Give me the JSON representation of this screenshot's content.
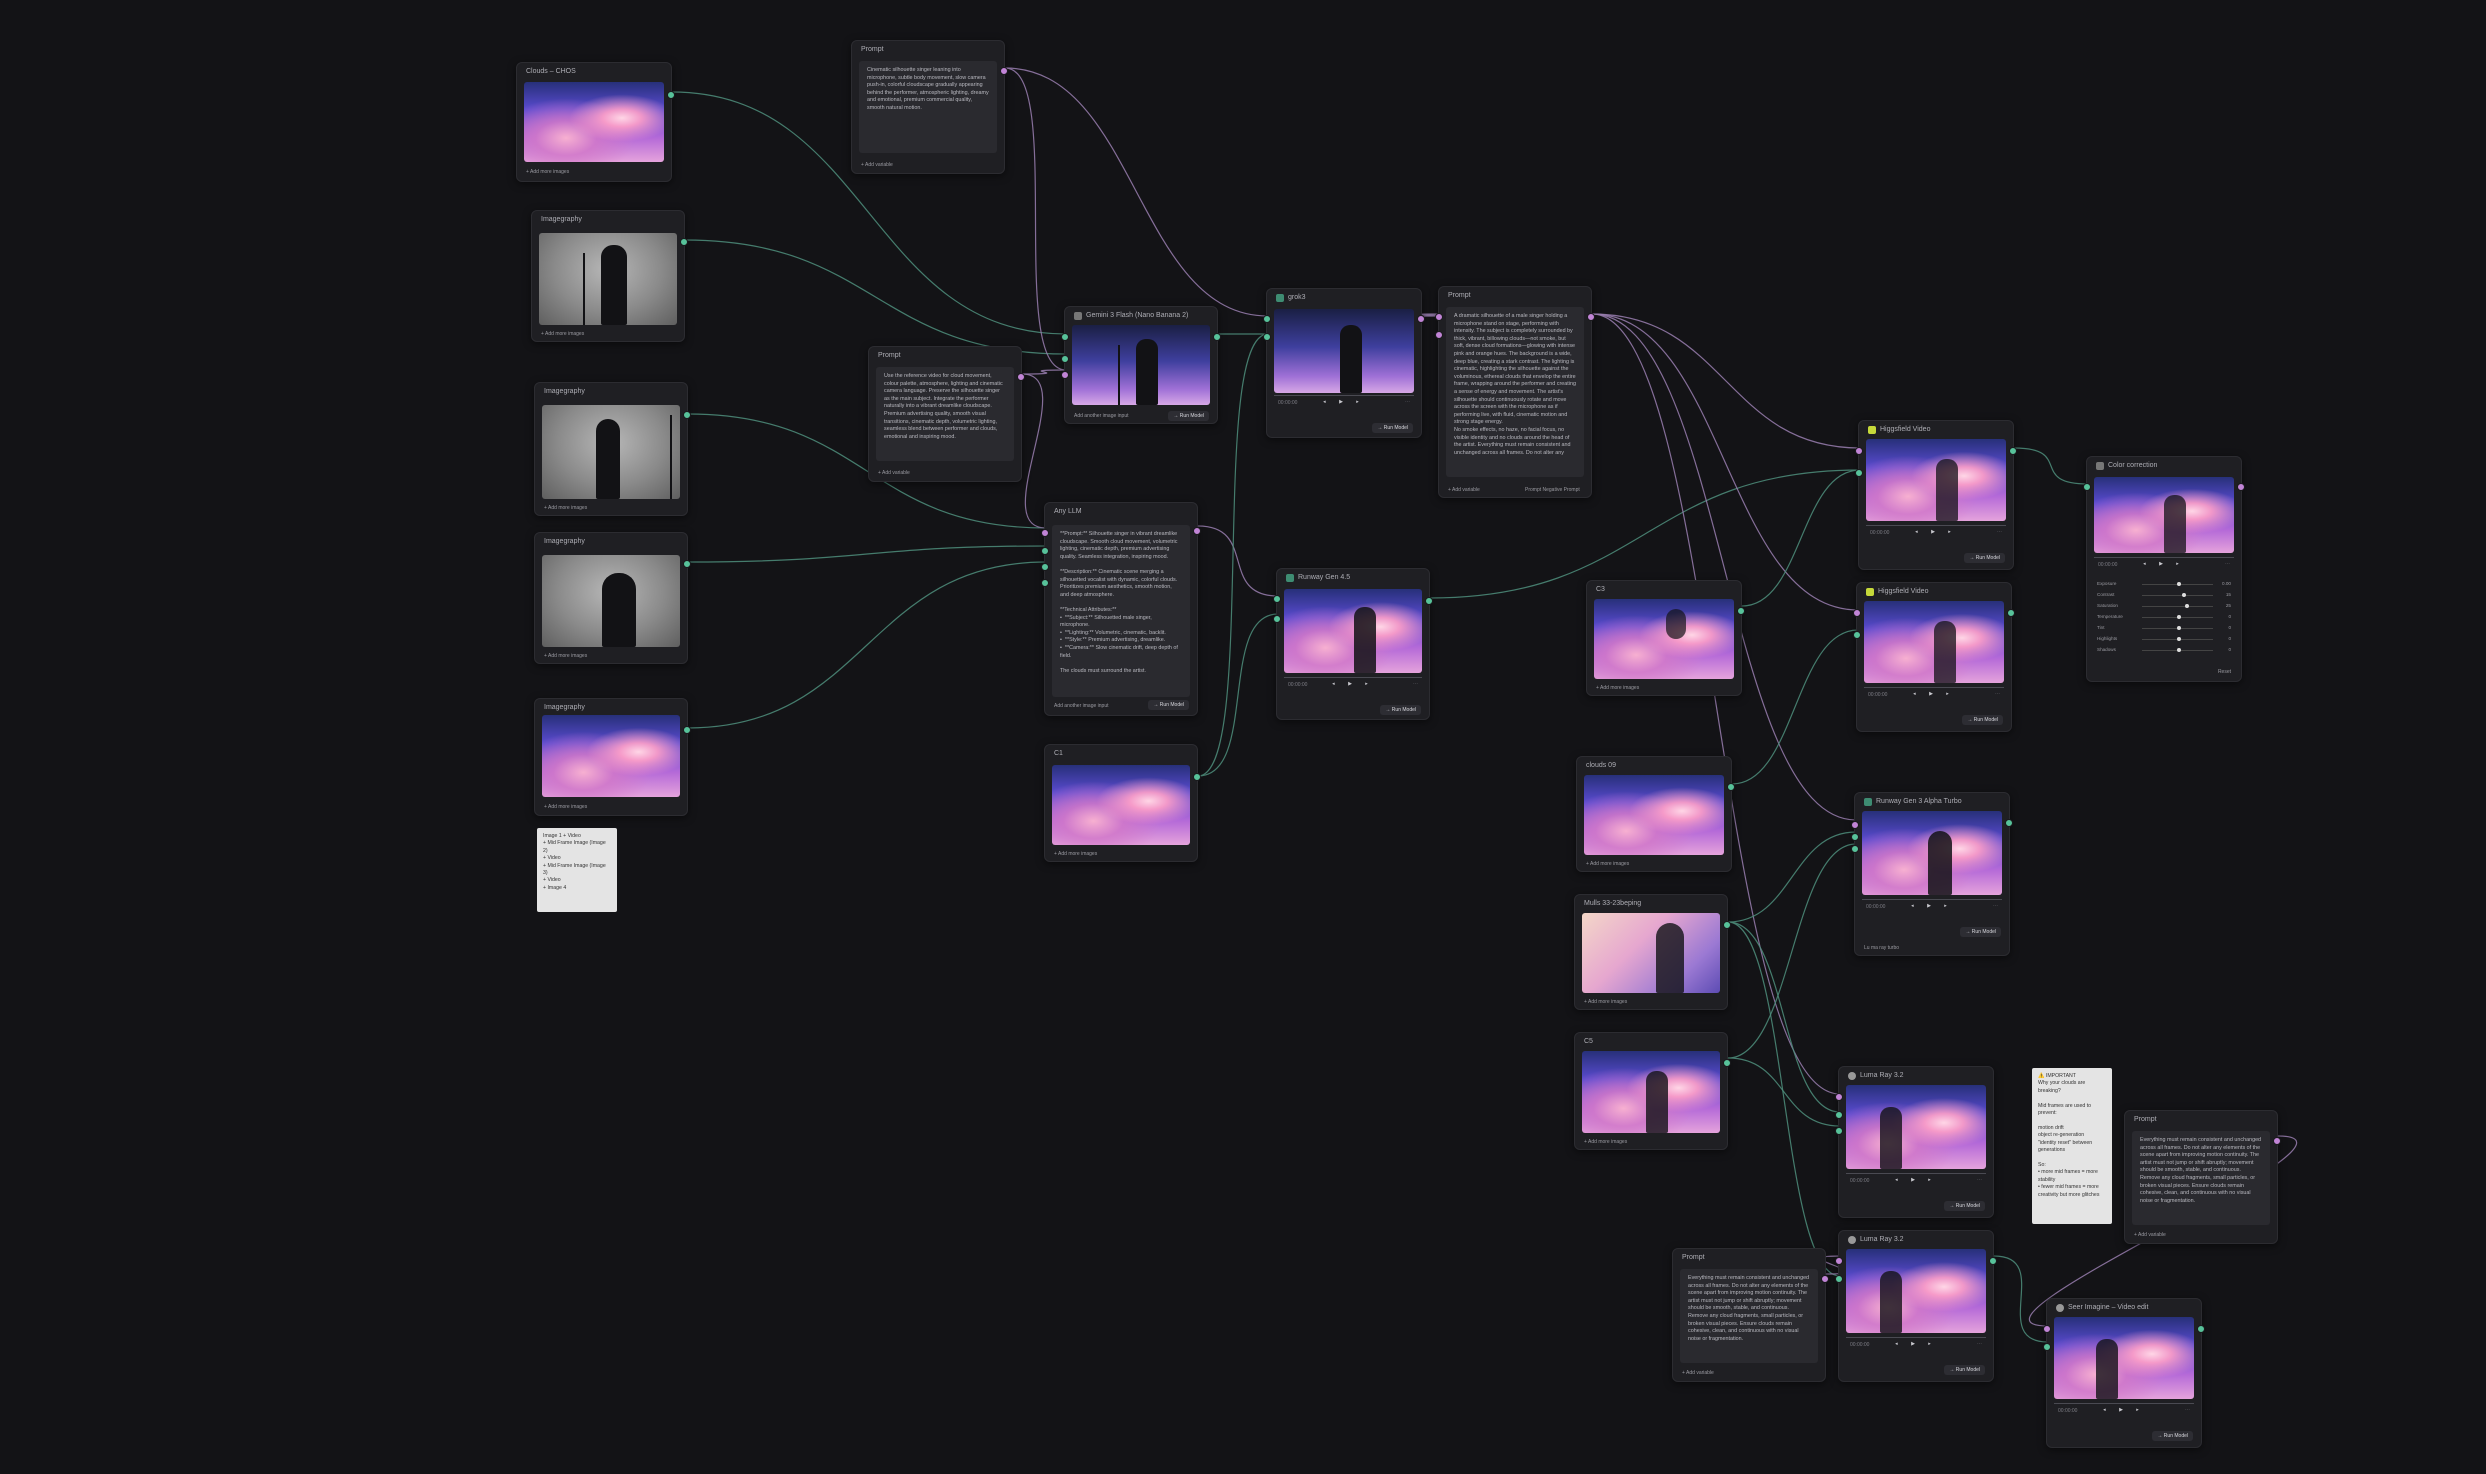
{
  "colors": {
    "canvas": "#131316",
    "node": "#1f1f23",
    "port_image": "#57c29a",
    "port_text": "#c184d6",
    "wire_image": "#4f8f7c",
    "wire_text": "#9a7fb0"
  },
  "ui": {
    "add_image": "+ Add more images",
    "add_variable": "+ Add variable",
    "run_model": "→ Run Model",
    "time": "00:00:00",
    "extract_input": "Add another image input",
    "prompt_tabs": "Prompt   Negative Prompt"
  },
  "nodes": {
    "n_clouds_chos": {
      "title": "Clouds – CHOS"
    },
    "n_prompt_top": {
      "title": "Prompt",
      "text": "Cinematic silhouette singer leaning into microphone, subtle body movement, slow camera push-in, colorful cloudscape gradually appearing behind the performer, atmospheric lighting, dreamy and emotional, premium commercial quality, smooth natural motion."
    },
    "n_img1": {
      "title": "Imagegraphy"
    },
    "n_img2": {
      "title": "Imagegraphy"
    },
    "n_img3": {
      "title": "Imagegraphy"
    },
    "n_img4": {
      "title": "Imagegraphy"
    },
    "n_prompt_ref": {
      "title": "Prompt",
      "text": "Use the reference video for cloud movement, colour palette, atmosphere, lighting and cinematic camera language. Preserve the silhouette singer as the main subject. Integrate the performer naturally into a vibrant dreamlike cloudscape. Premium advertising quality, smooth visual transitions, cinematic depth, volumetric lighting, seamless blend between performer and clouds, emotional and inspiring mood."
    },
    "n_gemini": {
      "title": "Gemini 3 Flash (Nano Banana 2)"
    },
    "n_anyllm": {
      "title": "Any LLM",
      "text": "**Prompt:** Silhouette singer in vibrant dreamlike cloudscape. Smooth cloud movement, volumetric lighting, cinematic depth, premium advertising quality. Seamless integration, inspiring mood.\n\n**Description:** Cinematic scene merging a silhouetted vocalist with dynamic, colorful clouds. Prioritizes premium aesthetics, smooth motion, and deep atmosphere.\n\n**Technical Attributes:**\n•  **Subject:** Silhouetted male singer, microphone.\n•  **Lighting:** Volumetric, cinematic, backlit.\n•  **Style:** Premium advertising, dreamlike.\n•  **Camera:** Slow cinematic drift, deep depth of field.\n\nThe clouds must surround the artist."
    },
    "n_grok": {
      "title": "grok3"
    },
    "n_runway_g43": {
      "title": "Runway Gen 4.5"
    },
    "n_c1": {
      "title": "C1"
    },
    "n_prompt_mid": {
      "title": "Prompt",
      "text": "A dramatic silhouette of a male singer holding a microphone stand on stage, performing with intensity. The subject is completely surrounded by thick, vibrant, billowing clouds—not smoke, but soft, dense cloud formations—glowing with intense pink and orange hues. The background is a wide, deep blue, creating a stark contrast. The lighting is cinematic, highlighting the silhouette against the voluminous, ethereal clouds that envelop the entire frame, wrapping around the performer and creating a sense of energy and movement. The artist's silhouette should continuously rotate and move across the screen with the microphone as if performing live, with fluid, cinematic motion and strong stage energy.\nNo smoke effects, no haze, no facial focus, no visible identity and no clouds around the head of the artist. Everything must remain consistent and unchanged across all frames. Do not alter any"
    },
    "n_c3": {
      "title": "C3"
    },
    "n_clouds09": {
      "title": "clouds 09"
    },
    "n_mulls": {
      "title": "Mulls 33-23beping"
    },
    "n_c5": {
      "title": "C5"
    },
    "n_higgs1": {
      "title": "Higgsfield Video"
    },
    "n_higgs2": {
      "title": "Higgsfield Video"
    },
    "n_color": {
      "title": "Color correction"
    },
    "n_runway_alpha": {
      "title": "Runway Gen 3 Alpha Turbo",
      "foot": "Lu ma ray turbo"
    },
    "n_luma1": {
      "title": "Luma Ray 3.2"
    },
    "n_luma2": {
      "title": "Luma Ray 3.2"
    },
    "n_prompt_br": {
      "title": "Prompt",
      "text": "Everything must remain consistent and unchanged across all frames. Do not alter any elements of the scene apart from improving motion continuity. The artist must not jump or shift abruptly; movement should be smooth, stable, and continuous. Remove any cloud fragments, small particles, or broken visual pieces. Ensure clouds remain cohesive, clean, and continuous with no visual noise or fragmentation."
    },
    "n_prompt_bl": {
      "title": "Prompt",
      "text": "Everything must remain consistent and unchanged across all frames. Do not alter any elements of the scene apart from improving motion continuity. The artist must not jump or shift abruptly; movement should be smooth, stable, and continuous. Remove any cloud fragments, small particles, or broken visual pieces. Ensure clouds remain cohesive, clean, and continuous with no visual noise or fragmentation."
    },
    "n_seed": {
      "title": "Seer Imagine – Video edit"
    }
  },
  "notes": {
    "left": "Image 1 + Video\n+ Mid Frame Image (Image 2)\n+ Video\n+ Mid Frame Image (Image 3)\n+ Video\n+ Image 4",
    "right": "⚠️ IMPORTANT\nWhy your clouds are breaking?\n\nMid frames are used to prevent:\n\nmotion drift\nobject re-generation\n\"identity reset\" between generations\n\nSo:\n• more mid frames = more stability\n• fewer mid frames = more creativity but more glitches"
  },
  "color_panel": {
    "rows": [
      {
        "label": "Exposure",
        "val": "0.00",
        "pos": 0.5
      },
      {
        "label": "Contrast",
        "val": "15",
        "pos": 0.57
      },
      {
        "label": "Saturation",
        "val": "25",
        "pos": 0.62
      },
      {
        "label": "Temperature",
        "val": "0",
        "pos": 0.5
      },
      {
        "label": "Tint",
        "val": "0",
        "pos": 0.5
      },
      {
        "label": "Highlights",
        "val": "0",
        "pos": 0.5
      },
      {
        "label": "Shadows",
        "val": "0",
        "pos": 0.5
      }
    ],
    "reset": "Reset"
  }
}
